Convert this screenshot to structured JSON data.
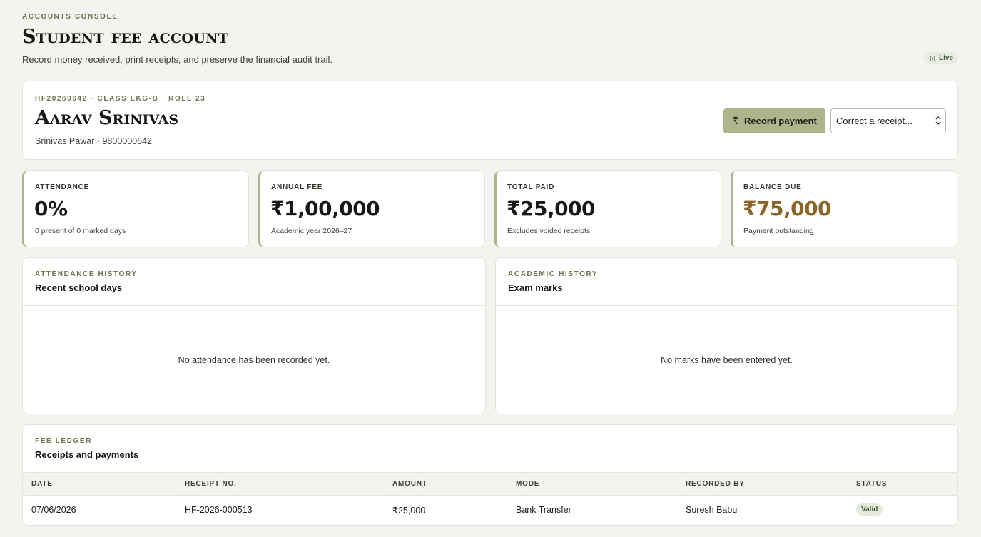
{
  "header": {
    "eyebrow": "Accounts console",
    "title": "Student fee account",
    "subtitle": "Record money received, print receipts, and preserve the financial audit trail.",
    "live_label": "Live"
  },
  "student": {
    "meta": "HF20260642 · Class LKG-B · Roll 23",
    "name": "Aarav Srinivas",
    "guardian": "Srinivas Pawar · 9800000642",
    "record_payment_label": "Record payment",
    "currency_symbol": "₹",
    "correct_select_value": "Correct a receipt..."
  },
  "stats": {
    "attendance": {
      "label": "Attendance",
      "value": "0%",
      "note": "0 present of 0 marked days"
    },
    "annual_fee": {
      "label": "Annual fee",
      "value": "₹1,00,000",
      "note": "Academic year 2026–27"
    },
    "total_paid": {
      "label": "Total paid",
      "value": "₹25,000",
      "note": "Excludes voided receipts"
    },
    "balance_due": {
      "label": "Balance due",
      "value": "₹75,000",
      "note": "Payment outstanding",
      "color": "#8d6424"
    }
  },
  "attendance_history": {
    "eyebrow": "Attendance history",
    "title": "Recent school days",
    "empty": "No attendance has been recorded yet."
  },
  "academic_history": {
    "eyebrow": "Academic history",
    "title": "Exam marks",
    "empty": "No marks have been entered yet."
  },
  "ledger": {
    "eyebrow": "Fee ledger",
    "title": "Receipts and payments",
    "columns": [
      "Date",
      "Receipt no.",
      "Amount",
      "Mode",
      "Recorded by",
      "Status"
    ],
    "rows": [
      {
        "date": "07/06/2026",
        "receipt": "HF-2026-000513",
        "amount": "₹25,000",
        "mode": "Bank Transfer",
        "recorded_by": "Suresh Babu",
        "status": "Valid"
      }
    ]
  },
  "colors": {
    "accent": "#aeb48b",
    "warning": "#8d6424",
    "valid": "#3e5a36"
  }
}
